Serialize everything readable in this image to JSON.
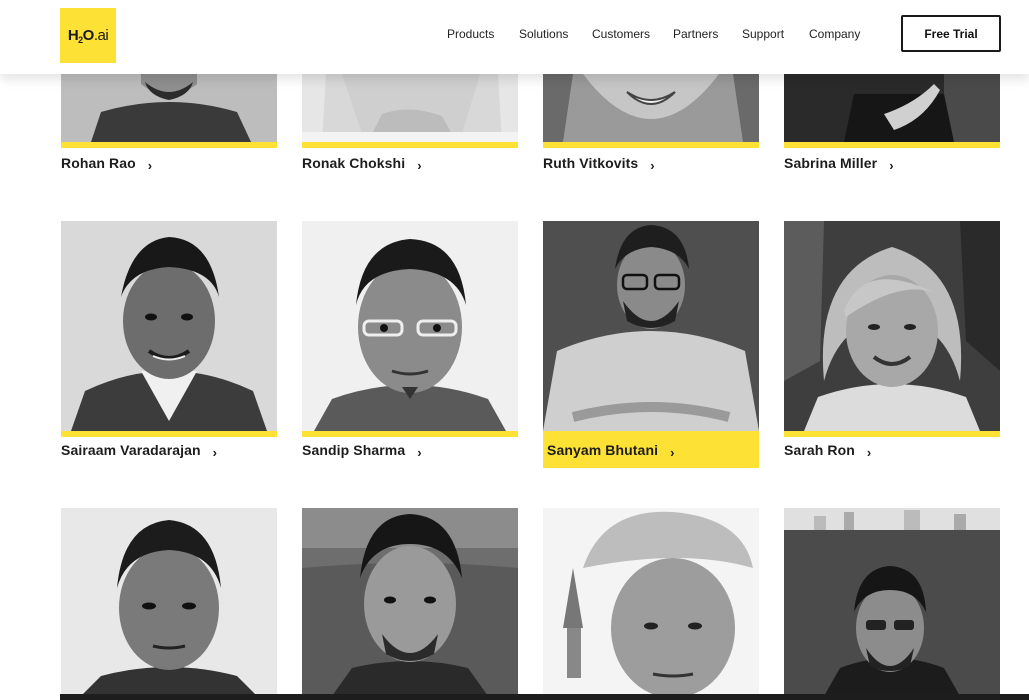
{
  "brand": {
    "logo_main": "H",
    "logo_sub": "2",
    "logo_o": "O",
    "logo_ai": ".ai",
    "accent_color": "#fee135"
  },
  "nav": {
    "items": [
      "Products",
      "Solutions",
      "Customers",
      "Partners",
      "Support",
      "Company"
    ],
    "cta_label": "Free Trial"
  },
  "people": [
    {
      "name": "Rohan Rao",
      "chevron": "›"
    },
    {
      "name": "Ronak Chokshi",
      "chevron": "›"
    },
    {
      "name": "Ruth Vitkovits",
      "chevron": "›"
    },
    {
      "name": "Sabrina Miller",
      "chevron": "›"
    },
    {
      "name": "Sairaam Varadarajan",
      "chevron": "›"
    },
    {
      "name": "Sandip Sharma",
      "chevron": "›"
    },
    {
      "name": "Sanyam Bhutani",
      "chevron": "›",
      "highlighted": true
    },
    {
      "name": "Sarah Ron",
      "chevron": "›"
    },
    {
      "name": "",
      "chevron": ""
    },
    {
      "name": "",
      "chevron": ""
    },
    {
      "name": "",
      "chevron": ""
    },
    {
      "name": "",
      "chevron": ""
    }
  ]
}
